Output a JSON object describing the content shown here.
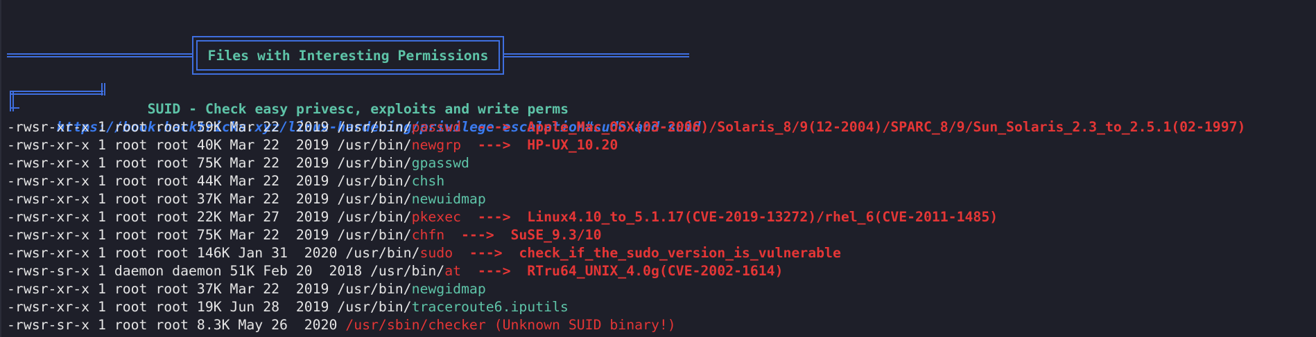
{
  "section": {
    "title": "Files with Interesting Permissions"
  },
  "suid_header": {
    "title": "SUID - Check easy privesc, exploits and write perms",
    "link": "https://book.hacktricks.xyz/linux-hardening/privilege-escalation#sudo-and-suid"
  },
  "rows": [
    {
      "prefix": "-rwsr-xr-x 1 root root 59K Mar 22  2019 /usr/bin/",
      "name": "passwd",
      "name_style": "red",
      "exploit": "  --->  Apple_Mac_OSX(03-2006)/Solaris_8/9(12-2004)/SPARC_8/9/Sun_Solaris_2.3_to_2.5.1(02-1997)"
    },
    {
      "prefix": "-rwsr-xr-x 1 root root 40K Mar 22  2019 /usr/bin/",
      "name": "newgrp",
      "name_style": "red",
      "exploit": "  --->  HP-UX_10.20"
    },
    {
      "prefix": "-rwsr-xr-x 1 root root 75K Mar 22  2019 /usr/bin/",
      "name": "gpasswd",
      "name_style": "green",
      "exploit": ""
    },
    {
      "prefix": "-rwsr-xr-x 1 root root 44K Mar 22  2019 /usr/bin/",
      "name": "chsh",
      "name_style": "green",
      "exploit": ""
    },
    {
      "prefix": "-rwsr-xr-x 1 root root 37K Mar 22  2019 /usr/bin/",
      "name": "newuidmap",
      "name_style": "green",
      "exploit": ""
    },
    {
      "prefix": "-rwsr-xr-x 1 root root 22K Mar 27  2019 /usr/bin/",
      "name": "pkexec",
      "name_style": "red",
      "exploit": "  --->  Linux4.10_to_5.1.17(CVE-2019-13272)/rhel_6(CVE-2011-1485)"
    },
    {
      "prefix": "-rwsr-xr-x 1 root root 75K Mar 22  2019 /usr/bin/",
      "name": "chfn",
      "name_style": "red",
      "exploit": "  --->  SuSE_9.3/10"
    },
    {
      "prefix": "-rwsr-xr-x 1 root root 146K Jan 31  2020 /usr/bin/",
      "name": "sudo",
      "name_style": "red",
      "exploit": "  --->  check_if_the_sudo_version_is_vulnerable"
    },
    {
      "prefix": "-rwsr-sr-x 1 daemon daemon 51K Feb 20  2018 /usr/bin/",
      "name": "at",
      "name_style": "red",
      "exploit": "  --->  RTru64_UNIX_4.0g(CVE-2002-1614)"
    },
    {
      "prefix": "-rwsr-xr-x 1 root root 37K Mar 22  2019 /usr/bin/",
      "name": "newgidmap",
      "name_style": "green",
      "exploit": ""
    },
    {
      "prefix": "-rwsr-xr-x 1 root root 19K Jun 28  2019 /usr/bin/",
      "name": "traceroute6.iputils",
      "name_style": "green",
      "exploit": ""
    },
    {
      "prefix": "-rwsr-sr-x 1 root root 8.3K May 26  2020 ",
      "name": "/usr/sbin/checker (Unknown SUID binary!)",
      "name_style": "red",
      "exploit": ""
    }
  ],
  "colors": {
    "background": "#1e1f29",
    "frame": "#3f6fe0",
    "title": "#5ec4a8",
    "link": "#3a7bf0",
    "vulnerable": "#e53636",
    "safe": "#5ec4a8",
    "text": "#e5e5e5"
  }
}
